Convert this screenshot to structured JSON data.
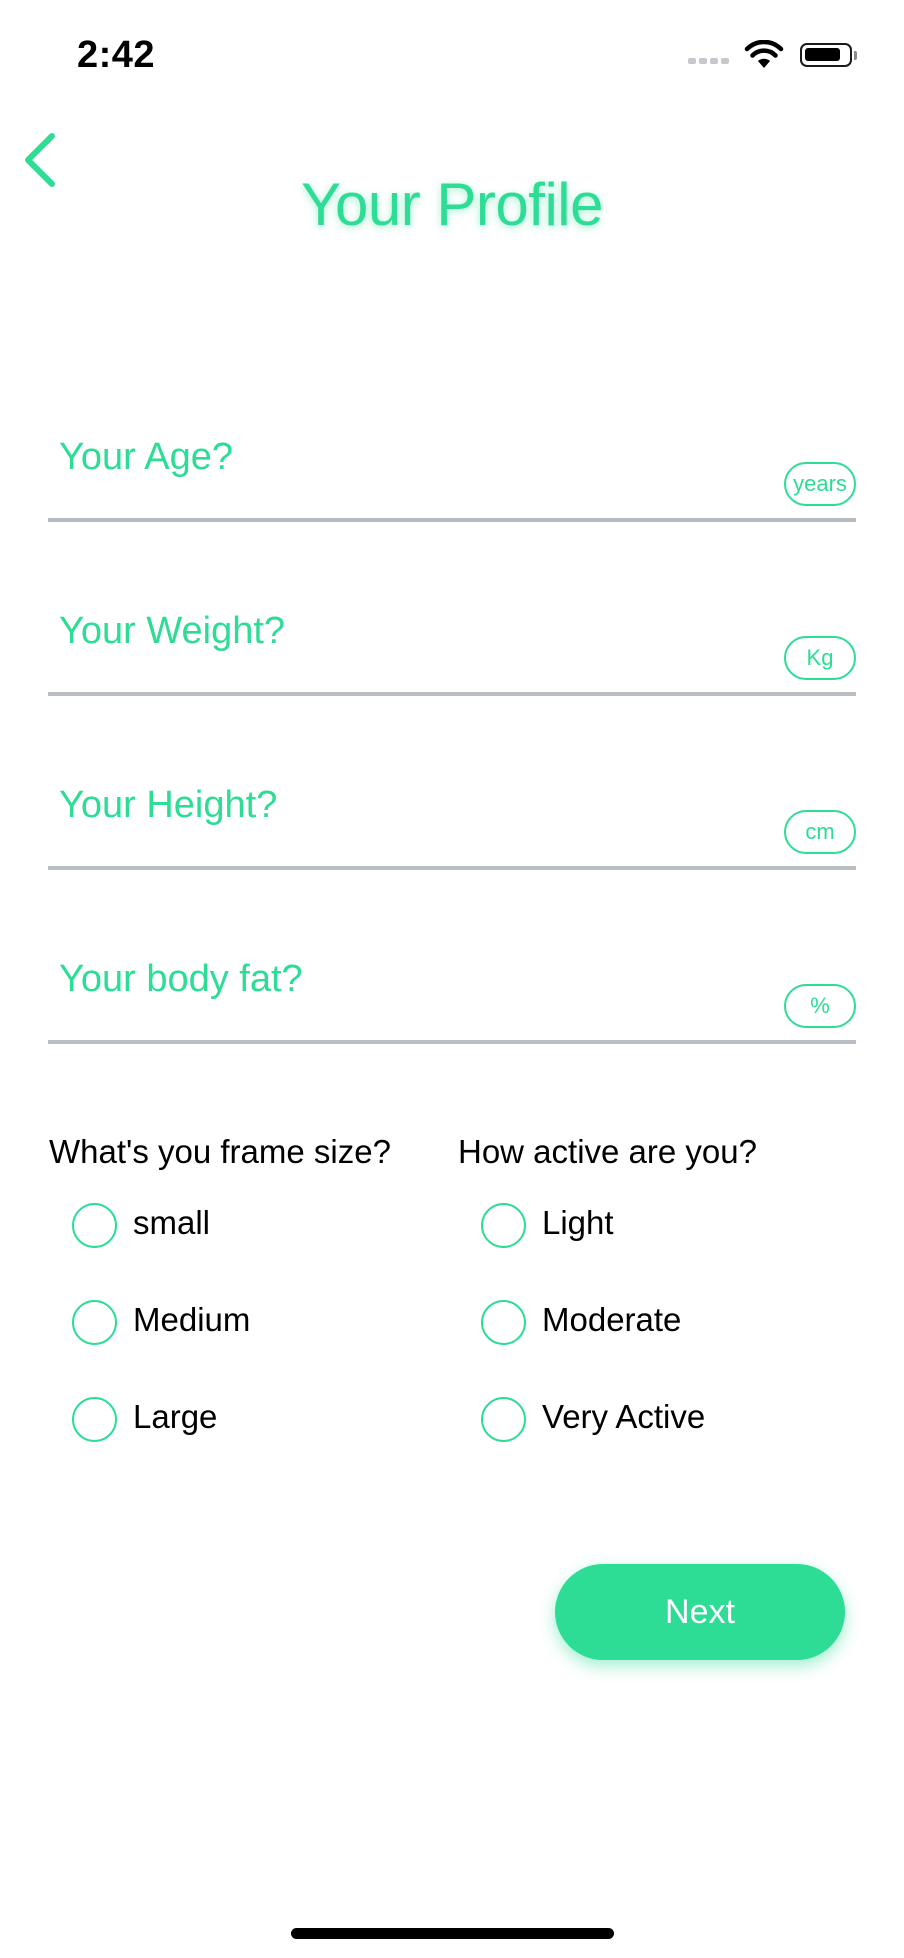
{
  "status_bar": {
    "time": "2:42"
  },
  "header": {
    "back_icon": "chevron-left-icon",
    "title": "Your Profile"
  },
  "fields": {
    "age": {
      "label": "Your Age?",
      "unit": "years",
      "value": ""
    },
    "weight": {
      "label": "Your Weight?",
      "unit": "Kg",
      "value": ""
    },
    "height": {
      "label": "Your Height?",
      "unit": "cm",
      "value": ""
    },
    "body_fat": {
      "label": "Your body fat?",
      "unit": "%",
      "value": ""
    }
  },
  "frame_size": {
    "title": "What's you frame size?",
    "options": [
      {
        "label": "small",
        "selected": false
      },
      {
        "label": "Medium",
        "selected": false
      },
      {
        "label": "Large",
        "selected": false
      }
    ]
  },
  "activity": {
    "title": "How active are you?",
    "options": [
      {
        "label": "Light",
        "selected": false
      },
      {
        "label": "Moderate",
        "selected": false
      },
      {
        "label": "Very Active",
        "selected": false
      }
    ]
  },
  "actions": {
    "next_label": "Next"
  },
  "colors": {
    "accent": "#2ddc95",
    "divider": "#b8bdc3",
    "text": "#000000",
    "background": "#ffffff"
  }
}
